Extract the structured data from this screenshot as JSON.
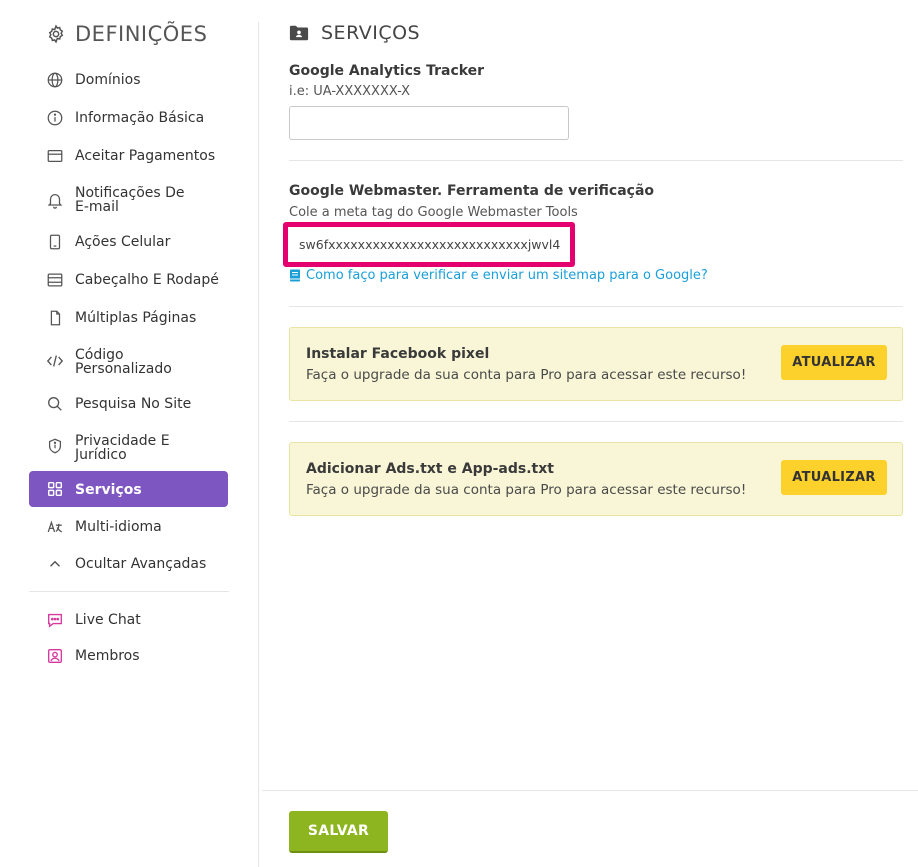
{
  "sidebar": {
    "title": "DEFINIÇÕES",
    "title_icon": "gear-icon",
    "items": [
      {
        "label": "Domínios",
        "icon": "globe-icon"
      },
      {
        "label": "Informação Básica",
        "icon": "info-icon"
      },
      {
        "label": "Aceitar Pagamentos",
        "icon": "card-icon"
      },
      {
        "label": "Notificações De\nE-mail",
        "icon": "bell-icon"
      },
      {
        "label": "Ações Celular",
        "icon": "mobile-icon"
      },
      {
        "label": "Cabeçalho E Rodapé",
        "icon": "layout-icon"
      },
      {
        "label": "Múltiplas Páginas",
        "icon": "pages-icon"
      },
      {
        "label": "Código\nPersonalizado",
        "icon": "code-icon"
      },
      {
        "label": "Pesquisa No Site",
        "icon": "search-icon"
      },
      {
        "label": "Privacidade E\nJurídico",
        "icon": "shield-icon"
      },
      {
        "label": "Serviços",
        "icon": "grid-icon",
        "active": true
      },
      {
        "label": "Multi-idioma",
        "icon": "translate-icon"
      },
      {
        "label": "Ocultar Avançadas",
        "icon": "chevron-up-icon"
      }
    ],
    "extra_items": [
      {
        "label": "Live Chat",
        "icon": "chat-icon"
      },
      {
        "label": "Membros",
        "icon": "members-icon"
      }
    ],
    "accent_color": "#7e56c2",
    "extra_icon_color": "#d6399e"
  },
  "main": {
    "title": "SERVIÇOS",
    "title_icon": "folder-user-icon",
    "analytics": {
      "label": "Google Analytics Tracker",
      "hint": "i.e: UA-XXXXXXX-X",
      "value": ""
    },
    "webmaster": {
      "label": "Google Webmaster. Ferramenta de verificação",
      "hint": "Cole a meta tag do Google Webmaster Tools",
      "value": "sw6fxxxxxxxxxxxxxxxxxxxxxxxxxxxjwvl4",
      "highlight_color": "#e5006f",
      "help_link": "Como faço para verificar e enviar um sitemap para o Google?"
    },
    "promos": [
      {
        "title": "Instalar Facebook pixel",
        "desc": "Faça o upgrade da sua conta para Pro para acessar este recurso!",
        "button": "ATUALIZAR"
      },
      {
        "title": "Adicionar Ads.txt e App-ads.txt",
        "desc": "Faça o upgrade da sua conta para Pro para acessar este recurso!",
        "button": "ATUALIZAR"
      }
    ],
    "save_label": "SALVAR",
    "save_color": "#8db51f",
    "upgrade_color": "#fcd12b"
  }
}
